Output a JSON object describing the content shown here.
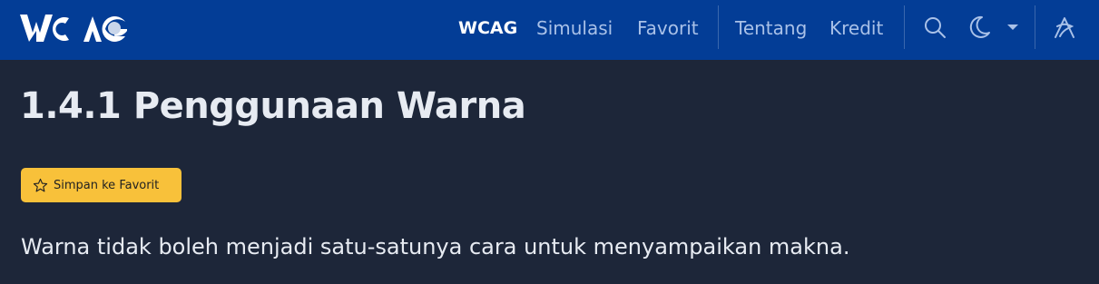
{
  "nav": {
    "logo_text": "WCAG",
    "links": [
      {
        "label": "WCAG",
        "active": true
      },
      {
        "label": "Simulasi",
        "active": false
      },
      {
        "label": "Favorit",
        "active": false
      },
      {
        "label": "Tentang",
        "active": false
      },
      {
        "label": "Kredit",
        "active": false
      }
    ],
    "icons": [
      "search-icon",
      "moon-icon",
      "caret-down-icon",
      "accessibility-icon"
    ]
  },
  "main": {
    "title": "1.4.1 Penggunaan Warna",
    "favorite_button": {
      "label": "Simpan ke Favorit",
      "icon": "star-icon"
    },
    "description": "Warna tidak boleh menjadi satu-satunya cara untuk menyampaikan makna."
  },
  "colors": {
    "navbar_bg": "#033d96",
    "page_bg": "#1d2639",
    "button_bg": "#f8c13a",
    "text": "#e7ebf2",
    "nav_link": "#a9c1e8"
  }
}
